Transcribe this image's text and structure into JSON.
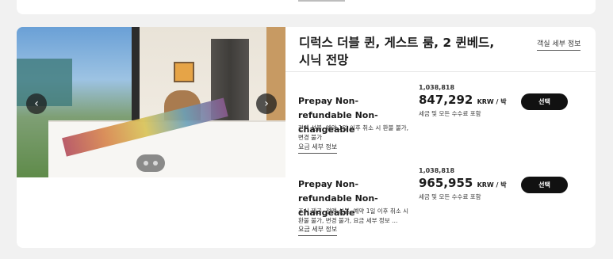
{
  "room": {
    "title": "디럭스 더블 퀸, 게스트 룸, 2 퀸베드, 시닉 전망",
    "details_link": "객실 세부 정보"
  },
  "rates": [
    {
      "name": "Prepay Non-refundable Non-changeable",
      "description": "전액 선불, 예약 1일 이후 취소 시 환불 불가, 변경 불가",
      "original_price": "1,038,818",
      "price": "847,292",
      "price_unit": "KRW / 박",
      "tax_note": "세금 및 모든 수수료 포함",
      "select_label": "선택",
      "details_link": "요금 세부 정보"
    },
    {
      "name": "Prepay Non-refundable Non-changeable",
      "description": "조식 제공, 전액 선불, 예약 1일 이후 취소 시 환불 불가, 변경 불가, 요금 세부 정보 …",
      "original_price": "1,038,818",
      "price": "965,955",
      "price_unit": "KRW / 박",
      "tax_note": "세금 및 모든 수수료 포함",
      "select_label": "선택",
      "details_link": "요금 세부 정보"
    }
  ],
  "carousel": {
    "prev_icon": "chevron-left-icon",
    "next_icon": "chevron-right-icon",
    "slide_count": 2
  },
  "colors": {
    "background": "#f1f1f1",
    "card": "#ffffff",
    "button": "#111111"
  }
}
